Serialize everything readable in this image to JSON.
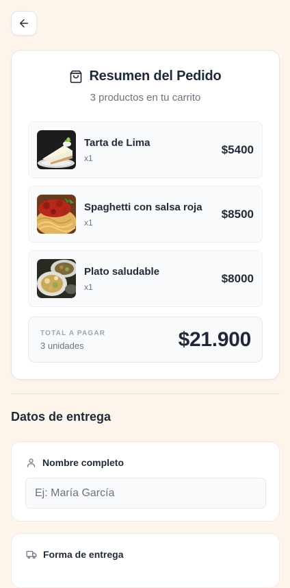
{
  "nav": {
    "back_icon": "arrow-left-icon"
  },
  "summary": {
    "icon": "shopping-bag-icon",
    "title": "Resumen del Pedido",
    "subtitle": "3 productos en tu carrito",
    "items": [
      {
        "name": "Tarta de Lima",
        "qty": "x1",
        "price": "$5400",
        "image": "lime-tart-photo"
      },
      {
        "name": "Spaghetti con salsa roja",
        "qty": "x1",
        "price": "$8500",
        "image": "spaghetti-photo"
      },
      {
        "name": "Plato saludable",
        "qty": "x1",
        "price": "$8000",
        "image": "healthy-dish-photo"
      }
    ],
    "total_label": "TOTAL A PAGAR",
    "total_units": "3 unidades",
    "total_amount": "$21.900"
  },
  "delivery": {
    "section_title": "Datos de entrega",
    "name_field": {
      "label": "Nombre completo",
      "icon": "user-icon",
      "placeholder": "Ej: María García",
      "value": ""
    },
    "method_field": {
      "label": "Forma de entrega",
      "icon": "truck-icon"
    }
  },
  "colors": {
    "background": "#fdf4ec",
    "card": "#ffffff",
    "text": "#1f2937",
    "muted": "#6b7280"
  }
}
